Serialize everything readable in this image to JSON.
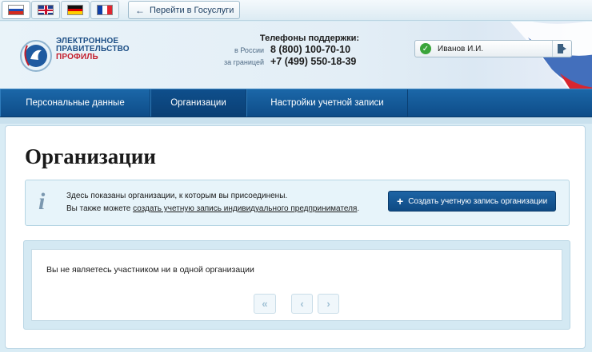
{
  "topbar": {
    "languages": [
      {
        "code": "ru",
        "active": true
      },
      {
        "code": "en",
        "active": false
      },
      {
        "code": "de",
        "active": false
      },
      {
        "code": "fr",
        "active": false
      }
    ],
    "gosuslugi_label": "Перейти в Госуслуги"
  },
  "header": {
    "logo_line1": "ЭЛЕКТРОННОЕ",
    "logo_line2": "ПРАВИТЕЛЬСТВО",
    "logo_line3": "ПРОФИЛЬ",
    "support_title": "Телефоны поддержки:",
    "phones": [
      {
        "label": "в России",
        "number": "8 (800) 100-70-10"
      },
      {
        "label": "за границей",
        "number": "+7 (499) 550-18-39"
      }
    ],
    "user_name": "Иванов И.И."
  },
  "nav": {
    "items": [
      {
        "label": "Персональные данные",
        "active": false
      },
      {
        "label": "Организации",
        "active": true
      },
      {
        "label": "Настройки учетной записи",
        "active": false
      }
    ]
  },
  "main": {
    "title": "Организации",
    "info_line1": "Здесь показаны организации, к которым вы присоединены.",
    "info_line2_prefix": "Вы также можете ",
    "info_line2_link": "создать учетную запись индивидуального предпринимателя",
    "info_line2_suffix": ".",
    "create_button": "Создать учетную запись организации",
    "empty_text": "Вы не являетесь участником ни в одной организации",
    "pager": {
      "first": "«",
      "prev": "‹",
      "next": "›"
    }
  },
  "colors": {
    "nav_bg": "#1b67a8",
    "button_bg": "#1d64a5",
    "accent_red": "#c41e2c",
    "status_ok": "#3aa43a"
  }
}
